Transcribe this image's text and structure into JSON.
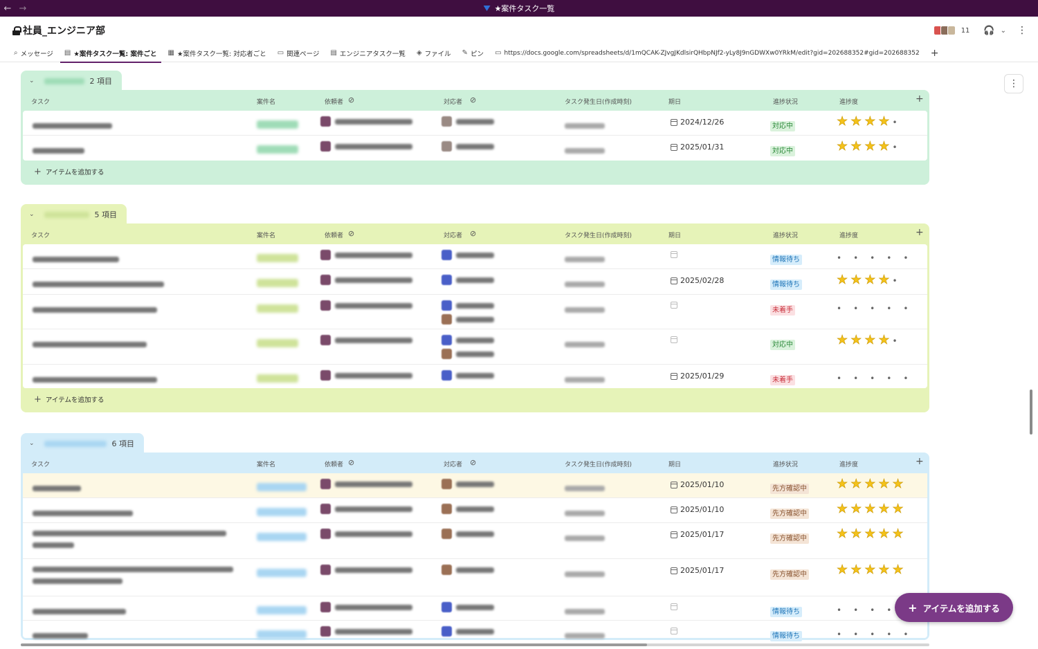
{
  "window_title": "★案件タスク一覧",
  "channel": {
    "name": "社員_エンジニア部",
    "member_count": "11"
  },
  "tabs": [
    {
      "icon": "search-icon",
      "label": "メッセージ"
    },
    {
      "icon": "canvas-icon",
      "label": "★案件タスク一覧: 案件ごと",
      "active": true
    },
    {
      "icon": "list-icon",
      "label": "★案件タスク一覧: 対応者ごと"
    },
    {
      "icon": "folder-icon",
      "label": "関連ページ"
    },
    {
      "icon": "canvas-icon",
      "label": "エンジニアタスク一覧"
    },
    {
      "icon": "layers-icon",
      "label": "ファイル"
    },
    {
      "icon": "pin-icon",
      "label": "ピン"
    },
    {
      "icon": "folder-icon",
      "label": "https://docs.google.com/spreadsheets/d/1mQCAK-ZJvgJKdlsirQHbpNJf2-yLy8J9nGDWXw0YRkM/edit?gid=202688352#gid=202688352"
    }
  ],
  "columns": {
    "task": "タスク",
    "project": "案件名",
    "requester": "依頼者",
    "assignee": "対応者",
    "created": "タスク発生日(作成時刻)",
    "due": "期日",
    "status": "進捗状況",
    "progress": "進捗度"
  },
  "add_item_label": "アイテムを追加する",
  "colors": {
    "group1": "#cdf0da",
    "group2": "#e6f3b8",
    "group3": "#d3ecf9",
    "fab": "#7b3a87",
    "star": "#f4c21a"
  },
  "groups": [
    {
      "count_label": "2 項目",
      "rows": [
        {
          "due": "2024/12/26",
          "status": "対応中",
          "status_type": "taio",
          "stars": 4
        },
        {
          "due": "2025/01/31",
          "status": "対応中",
          "status_type": "taio",
          "stars": 4
        }
      ]
    },
    {
      "count_label": "5 項目",
      "rows": [
        {
          "due": "",
          "status": "情報待ち",
          "status_type": "info",
          "stars": 0
        },
        {
          "due": "2025/02/28",
          "status": "情報待ち",
          "status_type": "info",
          "stars": 4
        },
        {
          "due": "",
          "status": "未着手",
          "status_type": "mi",
          "stars": 0
        },
        {
          "due": "",
          "status": "対応中",
          "status_type": "taio",
          "stars": 4
        },
        {
          "due": "2025/01/29",
          "status": "未着手",
          "status_type": "mi",
          "stars": 0
        }
      ]
    },
    {
      "count_label": "6 項目",
      "rows": [
        {
          "due": "2025/01/10",
          "status": "先方確認中",
          "status_type": "saki",
          "stars": 5
        },
        {
          "due": "2025/01/10",
          "status": "先方確認中",
          "status_type": "saki",
          "stars": 5
        },
        {
          "due": "2025/01/17",
          "status": "先方確認中",
          "status_type": "saki",
          "stars": 5
        },
        {
          "due": "2025/01/17",
          "status": "先方確認中",
          "status_type": "saki",
          "stars": 5
        },
        {
          "due": "",
          "status": "情報待ち",
          "status_type": "info",
          "stars": 0
        },
        {
          "due": "",
          "status": "情報待ち",
          "status_type": "info",
          "stars": 0
        }
      ]
    }
  ]
}
